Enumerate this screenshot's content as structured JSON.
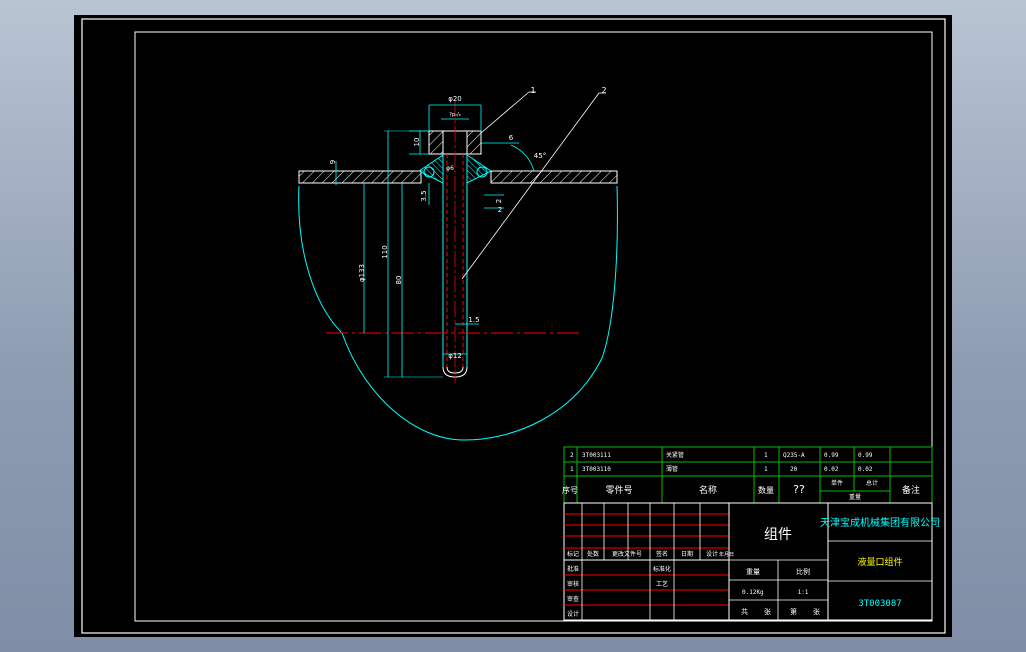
{
  "colors": {
    "background": "#000000",
    "frame": "#ffffff",
    "outline": "#00ffff",
    "hatch": "#ffffff",
    "dimension": "#ffffff",
    "centerline": "#ff0000",
    "leader": "#ffffff",
    "title_grid_green": "#00c000",
    "title_grid_red": "#ff0000",
    "title_text": "#ffffff",
    "title_text_cyan": "#00ffff",
    "title_text_yellow": "#ffff00"
  },
  "dimensions": {
    "phi20": "φ20",
    "top_fit": "?p₇/₆",
    "d10": "10",
    "d6": "6",
    "angle45": "45°",
    "d9": "9",
    "d3_5": "3.5",
    "d2a": "2",
    "d2b": "2",
    "phi133": "φ133",
    "d110": "110",
    "d80": "80",
    "d1_5": "1.5",
    "phi12": "φ12",
    "small_fit": "φ6"
  },
  "balloons": {
    "b1": "1",
    "b2": "2"
  },
  "parts_list": {
    "rows": [
      {
        "idx": "2",
        "code": "3T003111",
        "name": "关紧管",
        "qty": "1",
        "material": "Q235-A",
        "w1": "0.99",
        "w2": "0.99"
      },
      {
        "idx": "1",
        "code": "3T003110",
        "name": "薄管",
        "qty": "1",
        "material": "20",
        "w1": "0.02",
        "w2": "0.02"
      }
    ],
    "header": {
      "seq": "序号",
      "code": "零件号",
      "name": "名称",
      "qty": "数量",
      "material": "??",
      "single": "单件",
      "total": "总计",
      "weight": "重量",
      "note": "备注"
    }
  },
  "title_block": {
    "assembly_label": "组件",
    "company": "天津宝成机械集团有限公司",
    "drawing_name": "液量口组件",
    "drawing_number": "3T003087",
    "weight_label": "重量",
    "scale_label": "比例",
    "weight_value": "0.12Kg",
    "scale_value": "1:1",
    "sheets": "共",
    "sheet_label": "张",
    "page": "第",
    "page_label": "张",
    "revision_headers": [
      "标记",
      "处数",
      "更改文件号",
      "签名",
      "日期",
      "设计",
      "年月日"
    ],
    "signoff_labels": [
      "批准",
      "审核",
      "审查",
      "设计"
    ],
    "std_label": "标准化",
    "process_label": "工艺"
  }
}
